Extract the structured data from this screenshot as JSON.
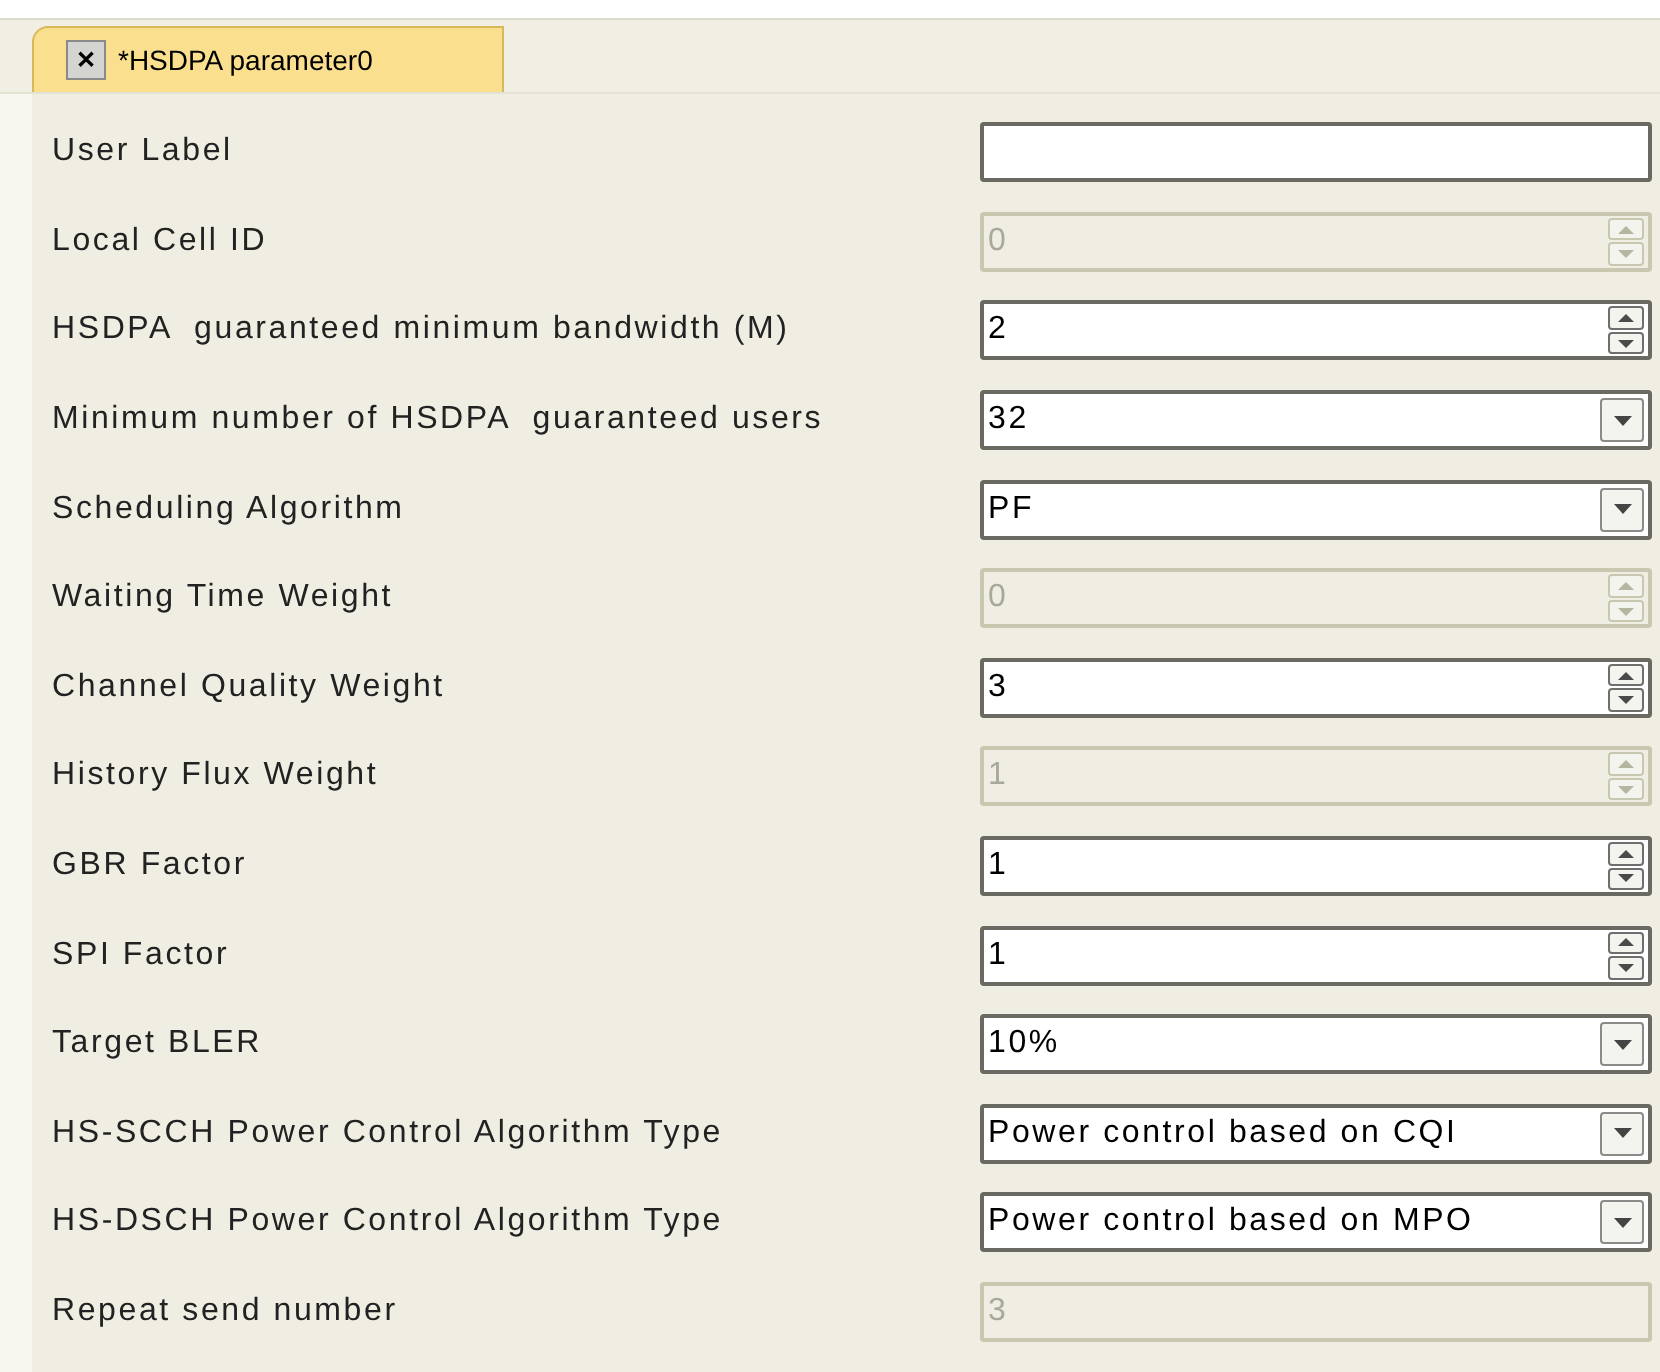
{
  "tab": {
    "title": "*HSDPA parameter0",
    "close": "✕",
    "selected": true
  },
  "fields": [
    {
      "label": "User Label",
      "kind": "text",
      "disabled": false
    },
    {
      "label": "Local Cell ID",
      "kind": "spinner",
      "value": "0",
      "disabled": true
    },
    {
      "label": "HSDPA  guaranteed minimum bandwidth (M)",
      "kind": "spinner",
      "value": "2",
      "disabled": false
    },
    {
      "label": "Minimum number of HSDPA  guaranteed users",
      "kind": "dropdown",
      "value": "32",
      "disabled": false
    },
    {
      "label": "Scheduling Algorithm",
      "kind": "dropdown",
      "value": "PF",
      "disabled": false
    },
    {
      "label": "Waiting Time Weight",
      "kind": "spinner",
      "value": "0",
      "disabled": true
    },
    {
      "label": "Channel Quality Weight",
      "kind": "spinner",
      "value": "3",
      "disabled": false
    },
    {
      "label": "History Flux Weight",
      "kind": "spinner",
      "value": "1",
      "disabled": true
    },
    {
      "label": "GBR Factor",
      "kind": "spinner",
      "value": "1",
      "disabled": false
    },
    {
      "label": "SPI Factor",
      "kind": "spinner",
      "value": "1",
      "disabled": false
    },
    {
      "label": "Target BLER",
      "kind": "dropdown",
      "value": "10%",
      "disabled": false
    },
    {
      "label": "HS-SCCH Power Control Algorithm Type",
      "kind": "dropdown",
      "value": "Power control based on CQI",
      "disabled": false
    },
    {
      "label": "HS-DSCH Power Control Algorithm Type",
      "kind": "dropdown",
      "value": "Power control based on MPO",
      "disabled": false
    },
    {
      "label": "Repeat send number",
      "kind": "text",
      "value": "3",
      "disabled": true
    }
  ]
}
